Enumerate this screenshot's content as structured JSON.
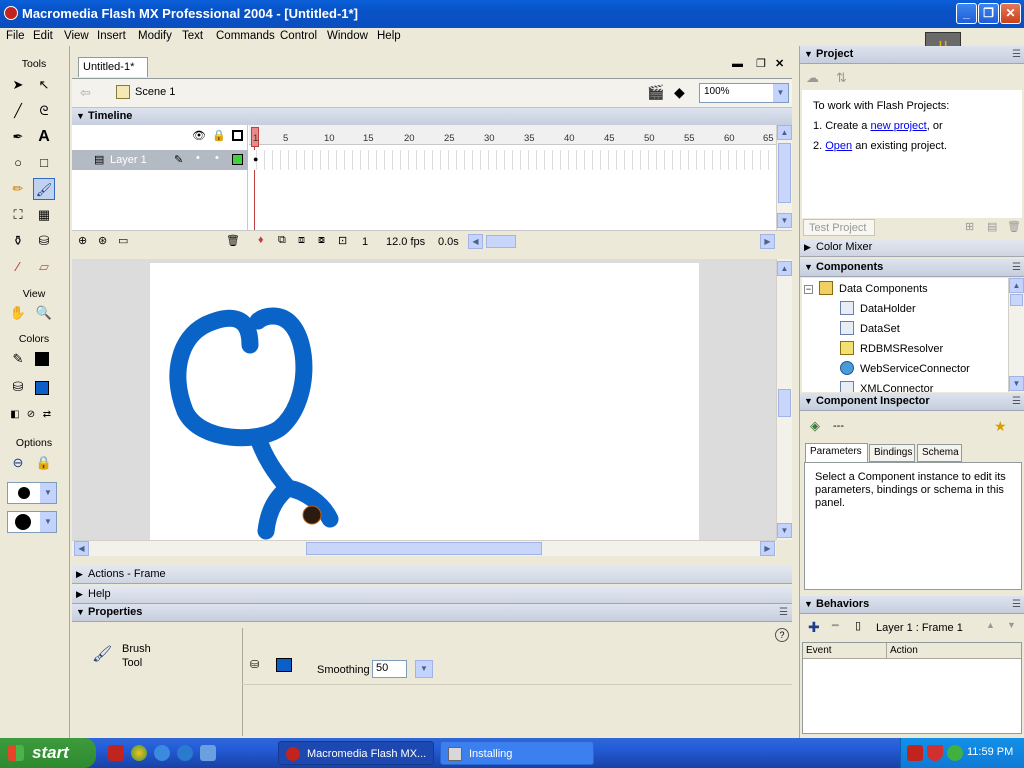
{
  "window": {
    "title": "Macromedia Flash MX Professional 2004 - [Untitled-1*]"
  },
  "menu": [
    "File",
    "Edit",
    "View",
    "Insert",
    "Modify",
    "Text",
    "Commands",
    "Control",
    "Window",
    "Help"
  ],
  "tools_panel": {
    "title": "Tools",
    "view_label": "View",
    "colors_label": "Colors",
    "options_label": "Options"
  },
  "document": {
    "tab": "Untitled-1*",
    "scene": "Scene 1",
    "zoom": "100%",
    "timeline_title": "Timeline",
    "layer_name": "Layer 1",
    "frame_numbers": [
      "1",
      "5",
      "10",
      "15",
      "20",
      "25",
      "30",
      "35",
      "40",
      "45",
      "50",
      "55",
      "60",
      "65"
    ],
    "current_frame": "1",
    "fps": "12.0 fps",
    "time": "0.0s"
  },
  "panels": {
    "actions": "Actions - Frame",
    "help": "Help",
    "properties": "Properties"
  },
  "properties": {
    "tool_line1": "Brush",
    "tool_line2": "Tool",
    "smoothing_label": "Smoothing",
    "smoothing_value": "50",
    "fill_color": "#0c5fc8"
  },
  "project": {
    "title": "Project",
    "intro": "To work with Flash Projects:",
    "step1_prefix": "1. Create a ",
    "step1_link": "new project",
    "step1_suffix": ", or",
    "step2_prefix": "2. ",
    "step2_link": "Open",
    "step2_suffix": " an existing project.",
    "test_button": "Test Project"
  },
  "color_mixer": {
    "title": "Color Mixer"
  },
  "components": {
    "title": "Components",
    "group": "Data Components",
    "items": [
      "DataHolder",
      "DataSet",
      "RDBMSResolver",
      "WebServiceConnector",
      "XMLConnector"
    ]
  },
  "component_inspector": {
    "title": "Component Inspector",
    "selection": "---",
    "tabs": [
      "Parameters",
      "Bindings",
      "Schema"
    ],
    "message": "Select a Component instance to edit its parameters, bindings or schema in this panel."
  },
  "behaviors": {
    "title": "Behaviors",
    "context": "Layer 1 : Frame 1",
    "col_event": "Event",
    "col_action": "Action"
  },
  "taskbar": {
    "start": "start",
    "tasks": [
      "Macromedia Flash MX...",
      "Installing"
    ],
    "clock": "11:59 PM"
  },
  "colors": {
    "stroke": "#000000",
    "fill": "#0c5fc8",
    "drawing": "#0a64c8",
    "keyframe": "#e88a8a"
  }
}
